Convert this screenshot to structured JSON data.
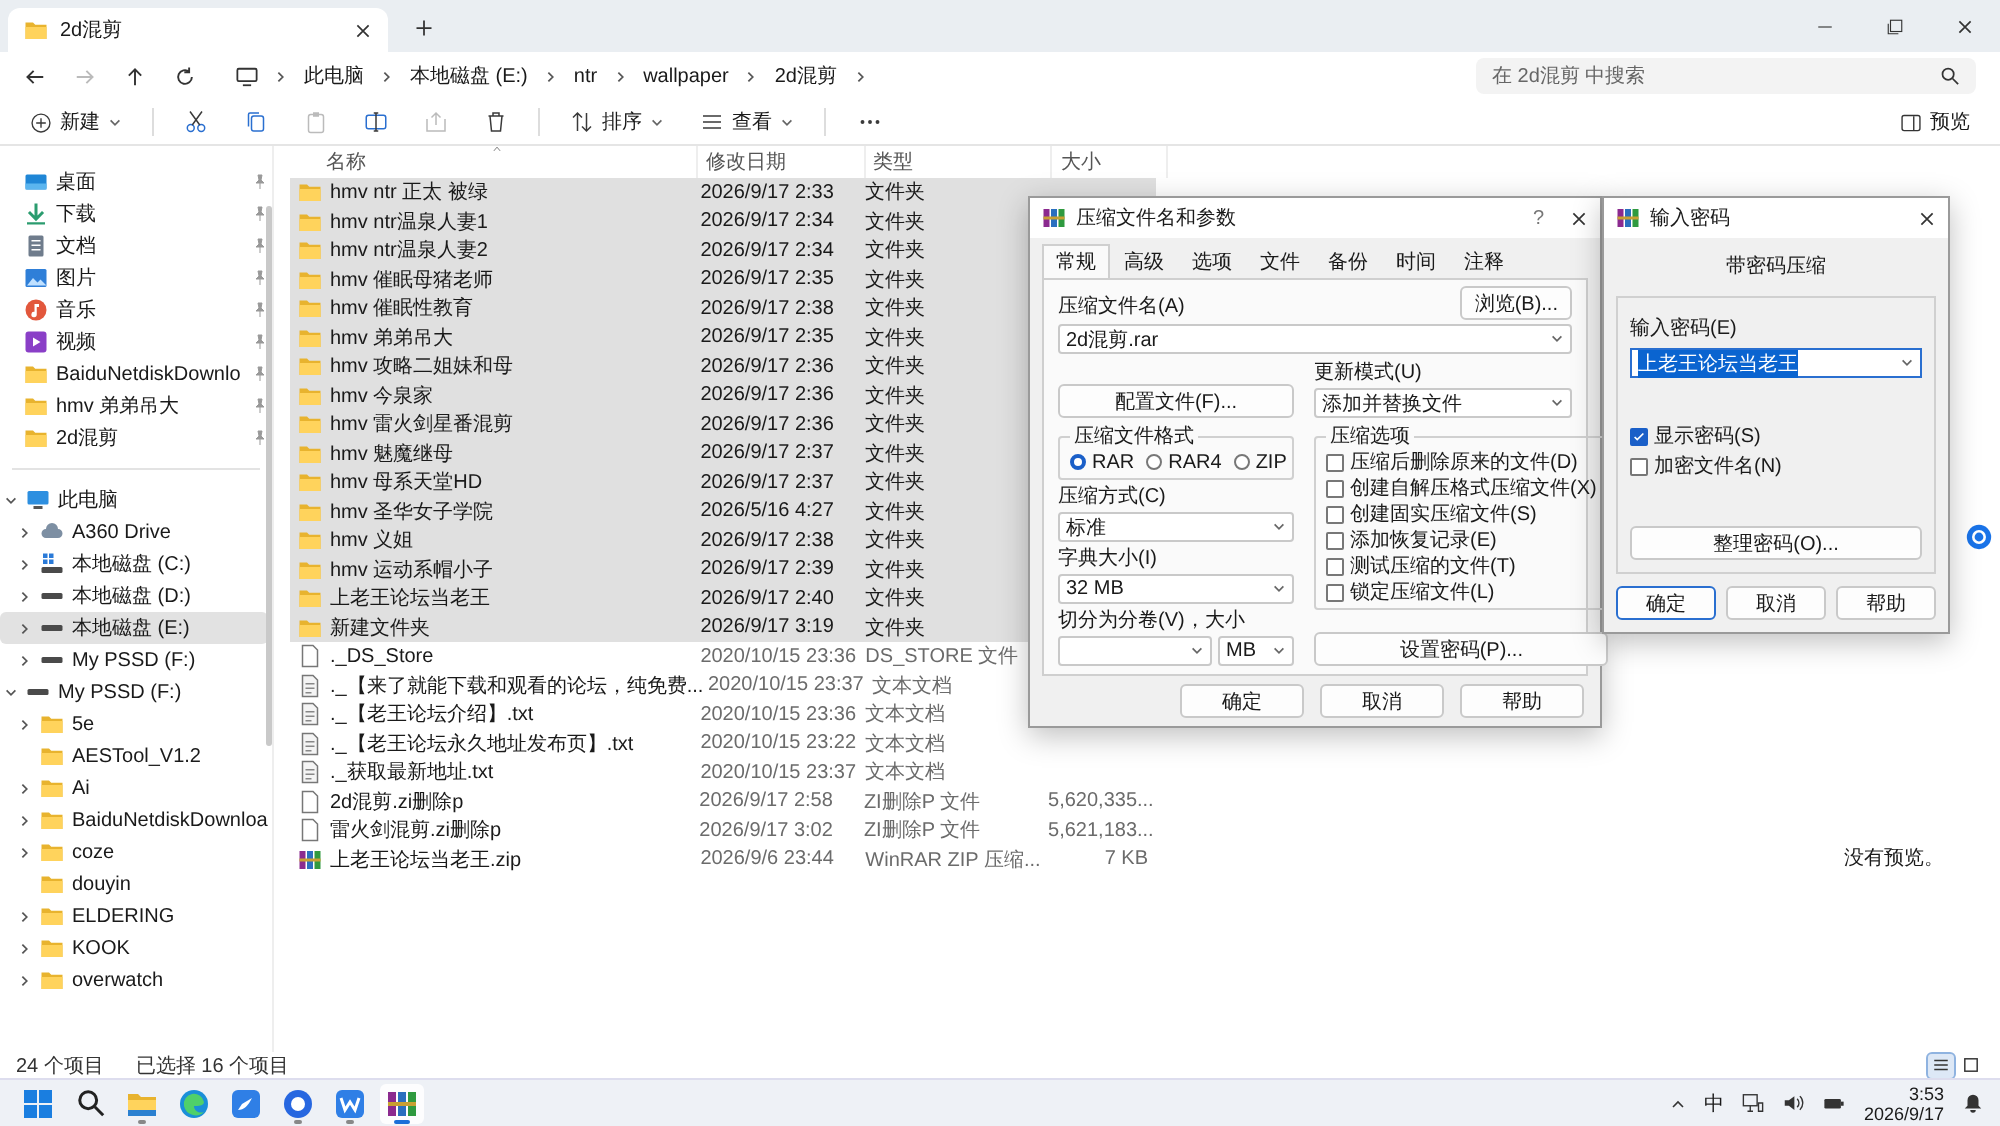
{
  "window": {
    "tab_title": "2d混剪"
  },
  "address": {
    "crumbs": [
      "此电脑",
      "本地磁盘 (E:)",
      "ntr",
      "wallpaper",
      "2d混剪"
    ],
    "search_placeholder": "在 2d混剪 中搜索"
  },
  "toolbar": {
    "items": [
      {
        "kind": "new",
        "label": "新建",
        "disabled": false
      },
      {
        "kind": "cut",
        "disabled": false
      },
      {
        "kind": "copy",
        "disabled": false
      },
      {
        "kind": "paste",
        "disabled": true
      },
      {
        "kind": "rename",
        "disabled": false
      },
      {
        "kind": "share",
        "disabled": true
      },
      {
        "kind": "delete",
        "disabled": false
      },
      {
        "kind": "sort",
        "label": "排序",
        "disabled": false
      },
      {
        "kind": "view",
        "label": "查看",
        "disabled": false
      },
      {
        "kind": "more",
        "disabled": false
      }
    ],
    "preview_button": "预览"
  },
  "sidebar": {
    "quick_access": [
      {
        "label": "桌面",
        "kind": "desktop",
        "pinned": true,
        "selected": false
      },
      {
        "label": "下载",
        "kind": "download",
        "pinned": true,
        "selected": false
      },
      {
        "label": "文档",
        "kind": "documents",
        "pinned": true,
        "selected": false
      },
      {
        "label": "图片",
        "kind": "pictures",
        "pinned": true,
        "selected": false
      },
      {
        "label": "音乐",
        "kind": "music",
        "pinned": true,
        "selected": false
      },
      {
        "label": "视频",
        "kind": "videos",
        "pinned": true,
        "selected": false
      },
      {
        "label": "BaiduNetdiskDownlo",
        "kind": "folder",
        "pinned": true,
        "selected": false
      },
      {
        "label": "hmv 弟弟吊大",
        "kind": "folder",
        "pinned": true,
        "selected": false
      },
      {
        "label": "2d混剪",
        "kind": "folder",
        "pinned": true,
        "selected": false
      }
    ],
    "tree": [
      {
        "label": "此电脑",
        "kind": "pc",
        "expandable": true,
        "expanded": true,
        "selected": false,
        "children": [
          {
            "label": "A360 Drive",
            "kind": "cloud",
            "expandable": true,
            "expanded": false,
            "selected": false
          },
          {
            "label": "本地磁盘 (C:)",
            "kind": "system_drive",
            "expandable": true,
            "expanded": false,
            "selected": false
          },
          {
            "label": "本地磁盘 (D:)",
            "kind": "drive",
            "expandable": true,
            "expanded": false,
            "selected": false
          },
          {
            "label": "本地磁盘 (E:)",
            "kind": "drive",
            "expandable": true,
            "expanded": false,
            "selected": true
          },
          {
            "label": "My PSSD (F:)",
            "kind": "drive",
            "expandable": true,
            "expanded": false,
            "selected": false
          }
        ]
      },
      {
        "label": "My PSSD (F:)",
        "kind": "drive",
        "expandable": true,
        "expanded": true,
        "selected": false,
        "children": [
          {
            "label": "5e",
            "kind": "folder",
            "expandable": true,
            "expanded": false,
            "selected": false
          },
          {
            "label": "AESTool_V1.2",
            "kind": "folder",
            "expandable": false,
            "expanded": false,
            "selected": false
          },
          {
            "label": "Ai",
            "kind": "folder",
            "expandable": true,
            "expanded": false,
            "selected": false
          },
          {
            "label": "BaiduNetdiskDownloa",
            "kind": "folder",
            "expandable": true,
            "expanded": false,
            "selected": false
          },
          {
            "label": "coze",
            "kind": "folder",
            "expandable": true,
            "expanded": false,
            "selected": false
          },
          {
            "label": "douyin",
            "kind": "folder",
            "expandable": false,
            "expanded": false,
            "selected": false
          },
          {
            "label": "ELDERING",
            "kind": "folder",
            "expandable": true,
            "expanded": false,
            "selected": false
          },
          {
            "label": "KOOK",
            "kind": "folder",
            "expandable": true,
            "expanded": false,
            "selected": false
          },
          {
            "label": "overwatch",
            "kind": "folder",
            "expandable": true,
            "expanded": false,
            "selected": false
          }
        ]
      }
    ]
  },
  "table": {
    "columns": [
      {
        "label": "名称",
        "sorted": true
      },
      {
        "label": "修改日期",
        "sorted": false
      },
      {
        "label": "类型",
        "sorted": false
      },
      {
        "label": "大小",
        "sorted": false
      }
    ],
    "rows": [
      {
        "name": "hmv ntr 正太 被绿",
        "date": "2026/9/17 2:33",
        "type": "文件夹",
        "kind": "folder",
        "selected": true
      },
      {
        "name": "hmv ntr温泉人妻1",
        "date": "2026/9/17 2:34",
        "type": "文件夹",
        "kind": "folder",
        "selected": true
      },
      {
        "name": "hmv ntr温泉人妻2",
        "date": "2026/9/17 2:34",
        "type": "文件夹",
        "kind": "folder",
        "selected": true
      },
      {
        "name": "hmv 催眠母猪老师",
        "date": "2026/9/17 2:35",
        "type": "文件夹",
        "kind": "folder",
        "selected": true
      },
      {
        "name": "hmv 催眠性教育",
        "date": "2026/9/17 2:38",
        "type": "文件夹",
        "kind": "folder",
        "selected": true
      },
      {
        "name": "hmv 弟弟吊大",
        "date": "2026/9/17 2:35",
        "type": "文件夹",
        "kind": "folder",
        "selected": true
      },
      {
        "name": "hmv 攻略二姐妹和母",
        "date": "2026/9/17 2:36",
        "type": "文件夹",
        "kind": "folder",
        "selected": true
      },
      {
        "name": "hmv 今泉家",
        "date": "2026/9/17 2:36",
        "type": "文件夹",
        "kind": "folder",
        "selected": true
      },
      {
        "name": "hmv 雷火剑星番混剪",
        "date": "2026/9/17 2:36",
        "type": "文件夹",
        "kind": "folder",
        "selected": true
      },
      {
        "name": "hmv 魅魔继母",
        "date": "2026/9/17 2:37",
        "type": "文件夹",
        "kind": "folder",
        "selected": true
      },
      {
        "name": "hmv 母系天堂HD",
        "date": "2026/9/17 2:37",
        "type": "文件夹",
        "kind": "folder",
        "selected": true
      },
      {
        "name": "hmv 圣华女子学院",
        "date": "2026/5/16 4:27",
        "type": "文件夹",
        "kind": "folder",
        "selected": true
      },
      {
        "name": "hmv 义姐",
        "date": "2026/9/17 2:38",
        "type": "文件夹",
        "kind": "folder",
        "selected": true
      },
      {
        "name": "hmv 运动系帽小子",
        "date": "2026/9/17 2:39",
        "type": "文件夹",
        "kind": "folder",
        "selected": true
      },
      {
        "name": "上老王论坛当老王",
        "date": "2026/9/17 2:40",
        "type": "文件夹",
        "kind": "folder",
        "selected": true
      },
      {
        "name": "新建文件夹",
        "date": "2026/9/17 3:19",
        "type": "文件夹",
        "kind": "folder",
        "selected": true
      },
      {
        "name": "._DS_Store",
        "date": "2020/10/15 23:36",
        "type": "DS_STORE 文件",
        "kind": "file",
        "selected": false
      },
      {
        "name": "._【来了就能下载和观看的论坛，纯免费...",
        "date": "2020/10/15 23:37",
        "type": "文本文档",
        "kind": "text",
        "selected": false
      },
      {
        "name": "._【老王论坛介绍】.txt",
        "date": "2020/10/15 23:36",
        "type": "文本文档",
        "kind": "text",
        "selected": false
      },
      {
        "name": "._【老王论坛永久地址发布页】.txt",
        "date": "2020/10/15 23:22",
        "type": "文本文档",
        "kind": "text",
        "selected": false
      },
      {
        "name": "._获取最新地址.txt",
        "date": "2020/10/15 23:37",
        "type": "文本文档",
        "kind": "text",
        "selected": false
      },
      {
        "name": "2d混剪.zi删除p",
        "date": "2026/9/17 2:58",
        "type": "ZI删除P 文件",
        "size": "5,620,335...",
        "kind": "file",
        "selected": false
      },
      {
        "name": "雷火剑混剪.zi删除p",
        "date": "2026/9/17 3:02",
        "type": "ZI删除P 文件",
        "size": "5,621,183...",
        "kind": "file",
        "selected": false
      },
      {
        "name": "上老王论坛当老王.zip",
        "date": "2026/9/6 23:44",
        "type": "WinRAR ZIP 压缩...",
        "size": "7 KB",
        "kind": "archive",
        "selected": false
      }
    ]
  },
  "preview": {
    "message": "没有预览。"
  },
  "status_bar": {
    "count": "24 个项目",
    "selection": "已选择 16 个项目",
    "views": [
      {
        "kind": "details",
        "selected": true
      },
      {
        "kind": "tiles",
        "selected": false
      }
    ]
  },
  "archive_dialog": {
    "title": "压缩文件名和参数",
    "help_button": "?",
    "tabs": [
      {
        "label": "常规",
        "selected": true
      },
      {
        "label": "高级",
        "selected": false
      },
      {
        "label": "选项",
        "selected": false
      },
      {
        "label": "文件",
        "selected": false
      },
      {
        "label": "备份",
        "selected": false
      },
      {
        "label": "时间",
        "selected": false
      },
      {
        "label": "注释",
        "selected": false
      }
    ],
    "name_label": "压缩文件名(A)",
    "browse_button": "浏览(B)...",
    "archive_name": "2d混剪.rar",
    "profiles_button": "配置文件(F)...",
    "update_label": "更新模式(U)",
    "update_mode": "添加并替换文件",
    "format_group": "压缩文件格式",
    "formats": [
      {
        "label": "RAR",
        "selected": true
      },
      {
        "label": "RAR4",
        "selected": false
      },
      {
        "label": "ZIP",
        "selected": false
      }
    ],
    "method_label": "压缩方式(C)",
    "method": "标准",
    "dict_label": "字典大小(I)",
    "dict": "32 MB",
    "split_label": "切分为分卷(V)，大小",
    "split_unit": "MB",
    "options_group": "压缩选项",
    "options": [
      {
        "label": "压缩后删除原来的文件(D)",
        "checked": false
      },
      {
        "label": "创建自解压格式压缩文件(X)",
        "checked": false
      },
      {
        "label": "创建固实压缩文件(S)",
        "checked": false
      },
      {
        "label": "添加恢复记录(E)",
        "checked": false
      },
      {
        "label": "测试压缩的文件(T)",
        "checked": false
      },
      {
        "label": "锁定压缩文件(L)",
        "checked": false
      }
    ],
    "password_button": "设置密码(P)...",
    "buttons": [
      {
        "label": "确定",
        "default": false
      },
      {
        "label": "取消",
        "default": false
      },
      {
        "label": "帮助",
        "default": false
      }
    ]
  },
  "password_dialog": {
    "title": "输入密码",
    "heading": "带密码压缩",
    "label": "输入密码(E)",
    "password": "上老王论坛当老王",
    "text_selected": true,
    "options": [
      {
        "label": "显示密码(S)",
        "checked": true
      },
      {
        "label": "加密文件名(N)",
        "checked": false
      }
    ],
    "organize_button": "整理密码(O)...",
    "buttons": [
      {
        "label": "确定",
        "default": true
      },
      {
        "label": "取消",
        "default": false
      },
      {
        "label": "帮助",
        "default": false
      }
    ]
  },
  "taskbar": {
    "apps": [
      {
        "kind": "start",
        "running": false,
        "active": false
      },
      {
        "kind": "search",
        "running": false,
        "active": false
      },
      {
        "kind": "explorer",
        "running": true,
        "active": false
      },
      {
        "kind": "edge",
        "running": false,
        "active": false
      },
      {
        "kind": "bird",
        "running": false,
        "active": false
      },
      {
        "kind": "chat",
        "running": true,
        "active": false
      },
      {
        "kind": "wps",
        "running": true,
        "active": false
      },
      {
        "kind": "winrar",
        "running": true,
        "active": true
      }
    ],
    "ime": "中",
    "time": "3:53",
    "date": "2026/9/17"
  }
}
